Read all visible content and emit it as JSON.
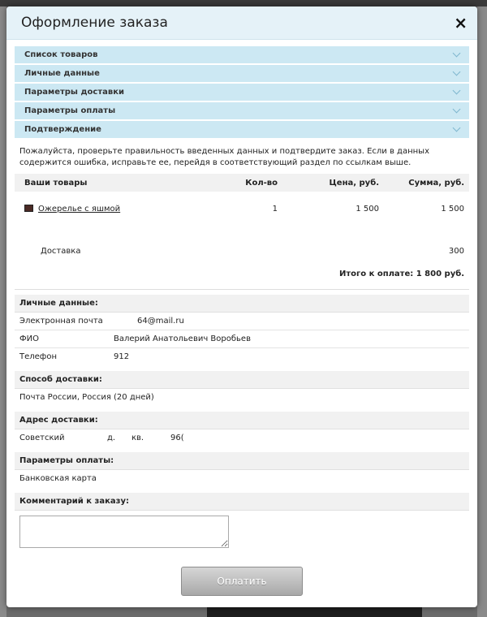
{
  "modal": {
    "title": "Оформление заказа",
    "close_icon": "×"
  },
  "accordion": [
    {
      "label": "Список товаров"
    },
    {
      "label": "Личные данные"
    },
    {
      "label": "Параметры доставки"
    },
    {
      "label": "Параметры оплаты"
    },
    {
      "label": "Подтверждение"
    }
  ],
  "notice": "Пожалуйста, проверьте правильность введенных данных и подтвердите заказ. Если в данных содержится ошибка, исправьте ее, перейдя в соответствующий раздел по ссылкам выше.",
  "items_table": {
    "headers": {
      "name": "Ваши товары",
      "qty": "Кол-во",
      "price": "Цена, руб.",
      "sum": "Сумма, руб."
    },
    "rows": [
      {
        "name": "Ожерелье с яшмой",
        "qty": "1",
        "price": "1 500",
        "sum": "1 500"
      }
    ],
    "delivery": {
      "label": "Доставка",
      "sum": "300"
    },
    "total": "Итого к оплате: 1 800 руб."
  },
  "personal": {
    "heading": "Личные данные:",
    "email_label": "Электронная почта",
    "email_value": "64@mail.ru",
    "name_label": "ФИО",
    "name_value": "Валерий Анатольевич Воробьев",
    "phone_label": "Телефон",
    "phone_value": "912"
  },
  "shipping": {
    "heading": "Способ доставки:",
    "value": "Почта России, Россия (20 дней)"
  },
  "address": {
    "heading": "Адрес доставки:",
    "city": "Советский",
    "house": "д.",
    "apt": "кв.",
    "index": "96("
  },
  "payment": {
    "heading": "Параметры оплаты:",
    "value": "Банковская карта"
  },
  "comment": {
    "heading": "Комментарий к заказу:"
  },
  "pay_button": "Оплатить"
}
